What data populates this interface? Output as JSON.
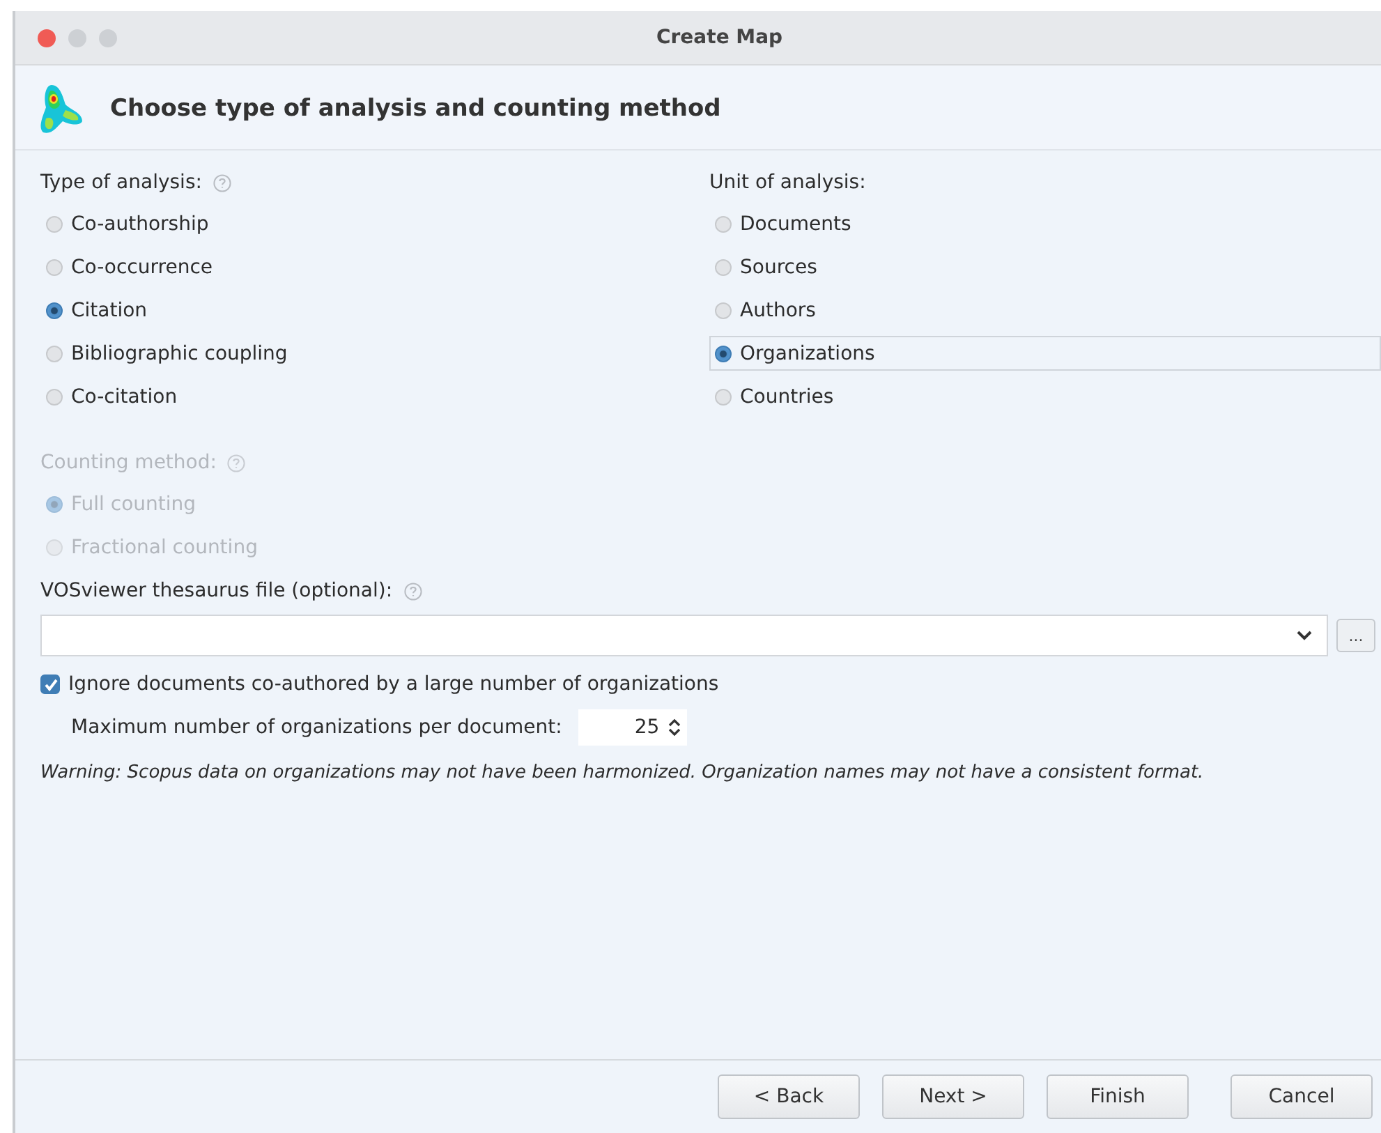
{
  "window": {
    "title": "Create Map"
  },
  "header": {
    "title": "Choose type of analysis and counting method"
  },
  "type_of_analysis": {
    "label": "Type of analysis:",
    "options": [
      {
        "label": "Co-authorship",
        "selected": false
      },
      {
        "label": "Co-occurrence",
        "selected": false
      },
      {
        "label": "Citation",
        "selected": true
      },
      {
        "label": "Bibliographic coupling",
        "selected": false
      },
      {
        "label": "Co-citation",
        "selected": false
      }
    ]
  },
  "unit_of_analysis": {
    "label": "Unit of analysis:",
    "options": [
      {
        "label": "Documents",
        "selected": false
      },
      {
        "label": "Sources",
        "selected": false
      },
      {
        "label": "Authors",
        "selected": false
      },
      {
        "label": "Organizations",
        "selected": true
      },
      {
        "label": "Countries",
        "selected": false
      }
    ]
  },
  "counting_method": {
    "label": "Counting method:",
    "disabled": true,
    "options": [
      {
        "label": "Full counting",
        "selected": true
      },
      {
        "label": "Fractional counting",
        "selected": false
      }
    ]
  },
  "thesaurus": {
    "label": "VOSviewer thesaurus file (optional):",
    "browse_label": "..."
  },
  "ignore_option": {
    "label": "Ignore documents co-authored by a large number of organizations",
    "checked": true
  },
  "max_per_document": {
    "label": "Maximum number of organizations per document:",
    "value": "25"
  },
  "warning": "Warning: Scopus data on organizations may not have been harmonized. Organization names may not have a consistent format.",
  "buttons": [
    {
      "label": "< Back"
    },
    {
      "label": "Next >"
    },
    {
      "label": "Finish"
    },
    {
      "label": "Cancel"
    }
  ]
}
